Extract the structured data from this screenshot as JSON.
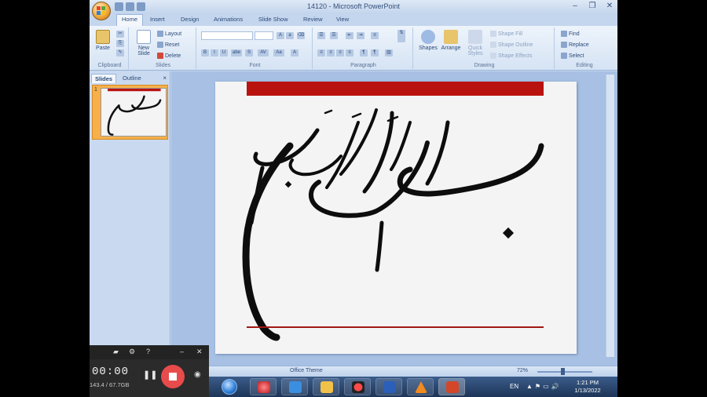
{
  "window": {
    "title": "14120 - Microsoft PowerPoint",
    "controls": [
      "–",
      "❐",
      "✕"
    ]
  },
  "ribbon": {
    "tabs": [
      "Home",
      "Insert",
      "Design",
      "Animations",
      "Slide Show",
      "Review",
      "View"
    ],
    "clipboard": {
      "paste": "Paste",
      "label": "Clipboard"
    },
    "slides": {
      "new_slide": "New Slide",
      "layout": "Layout",
      "reset": "Reset",
      "delete": "Delete",
      "label": "Slides"
    },
    "font": {
      "label": "Font",
      "format_buttons": [
        "B",
        "I",
        "U",
        "abe",
        "S",
        "AV",
        "Aa",
        "A"
      ]
    },
    "paragraph": {
      "label": "Paragraph"
    },
    "drawing": {
      "shapes": "Shapes",
      "arrange": "Arrange",
      "quick_styles": "Quick Styles",
      "shape_fill": "Shape Fill",
      "shape_outline": "Shape Outline",
      "shape_effects": "Shape Effects",
      "label": "Drawing"
    },
    "editing": {
      "find": "Find",
      "replace": "Replace",
      "select": "Select",
      "label": "Editing"
    }
  },
  "pane": {
    "tabs": [
      "Slides",
      "Outline"
    ],
    "close": "×",
    "thumbnail_number": "1"
  },
  "status": {
    "text": "Office Theme",
    "zoom": "72%"
  },
  "taskbar": {
    "language": "EN",
    "time": "1:21 PM",
    "date": "1/13/2022"
  },
  "recorder": {
    "elapsed": "00:00",
    "storage": "143.4 / 67.7GB"
  }
}
